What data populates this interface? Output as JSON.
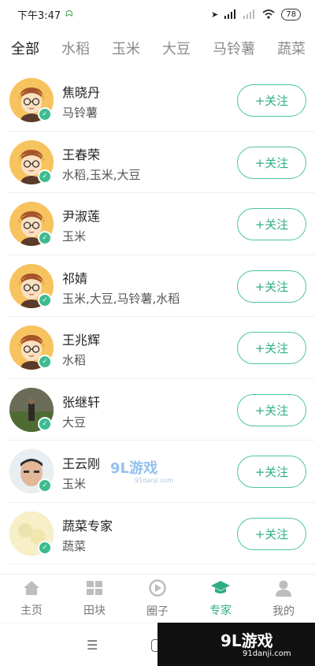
{
  "status": {
    "time": "下午3:47",
    "battery": "78"
  },
  "tabs": [
    {
      "label": "全部",
      "active": true
    },
    {
      "label": "水稻",
      "active": false
    },
    {
      "label": "玉米",
      "active": false
    },
    {
      "label": "大豆",
      "active": false
    },
    {
      "label": "马铃薯",
      "active": false
    },
    {
      "label": "蔬菜",
      "active": false
    }
  ],
  "users": [
    {
      "name": "焦晓丹",
      "crops": "马铃薯",
      "follow_label": "+关注"
    },
    {
      "name": "王春荣",
      "crops": "水稻,玉米,大豆",
      "follow_label": "+关注"
    },
    {
      "name": "尹淑莲",
      "crops": "玉米",
      "follow_label": "+关注"
    },
    {
      "name": "祁婧",
      "crops": "玉米,大豆,马铃薯,水稻",
      "follow_label": "+关注"
    },
    {
      "name": "王兆辉",
      "crops": "水稻",
      "follow_label": "+关注"
    },
    {
      "name": "张继轩",
      "crops": "大豆",
      "follow_label": "+关注"
    },
    {
      "name": "王云刚",
      "crops": "玉米",
      "follow_label": "+关注"
    },
    {
      "name": "蔬菜专家",
      "crops": "蔬菜",
      "follow_label": "+关注"
    }
  ],
  "bottom_nav": [
    {
      "label": "主页",
      "icon": "home-icon",
      "active": false
    },
    {
      "label": "田块",
      "icon": "field-icon",
      "active": false
    },
    {
      "label": "圈子",
      "icon": "circle-icon",
      "active": false
    },
    {
      "label": "专家",
      "icon": "expert-icon",
      "active": true
    },
    {
      "label": "我的",
      "icon": "profile-icon",
      "active": false
    }
  ],
  "watermark": {
    "center_logo": "9L游戏",
    "center_url": "91danji.com",
    "corner_logo": "9L游戏",
    "corner_url": "91danji.com"
  },
  "colors": {
    "accent": "#2fae86",
    "avatar_yellow": "#f7c35f"
  }
}
